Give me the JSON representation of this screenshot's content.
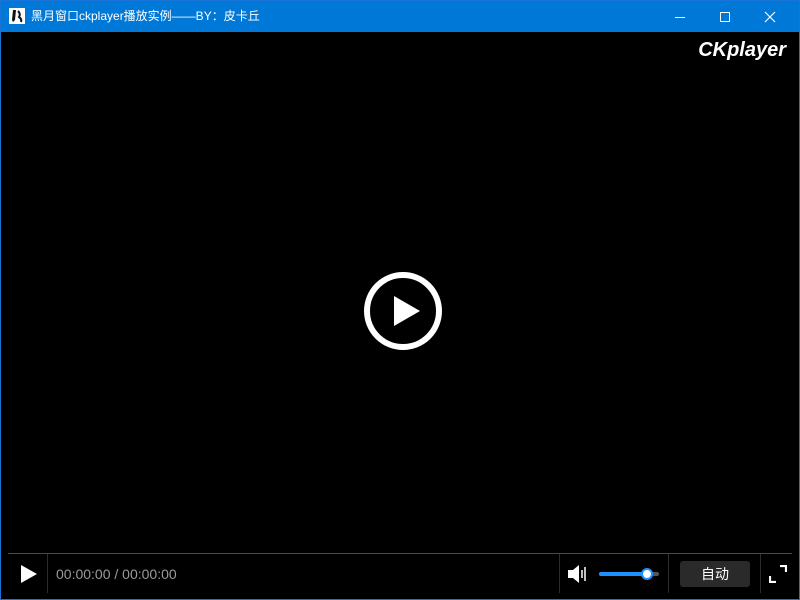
{
  "window": {
    "title": "黑月窗口ckplayer播放实例——BY：皮卡丘"
  },
  "player": {
    "brand": "CKplayer",
    "time": "00:00:00 / 00:00:00",
    "volume_fraction": 0.8,
    "quality_label": "自动"
  },
  "icons": {
    "app": "app-icon",
    "minimize": "minimize-icon",
    "maximize": "maximize-icon",
    "close": "close-icon",
    "big_play": "play-circle-icon",
    "play": "play-icon",
    "volume": "volume-icon",
    "fullscreen": "fullscreen-icon"
  },
  "colors": {
    "titlebar": "#0078d7",
    "accent": "#1e90ff",
    "background": "#000000"
  }
}
